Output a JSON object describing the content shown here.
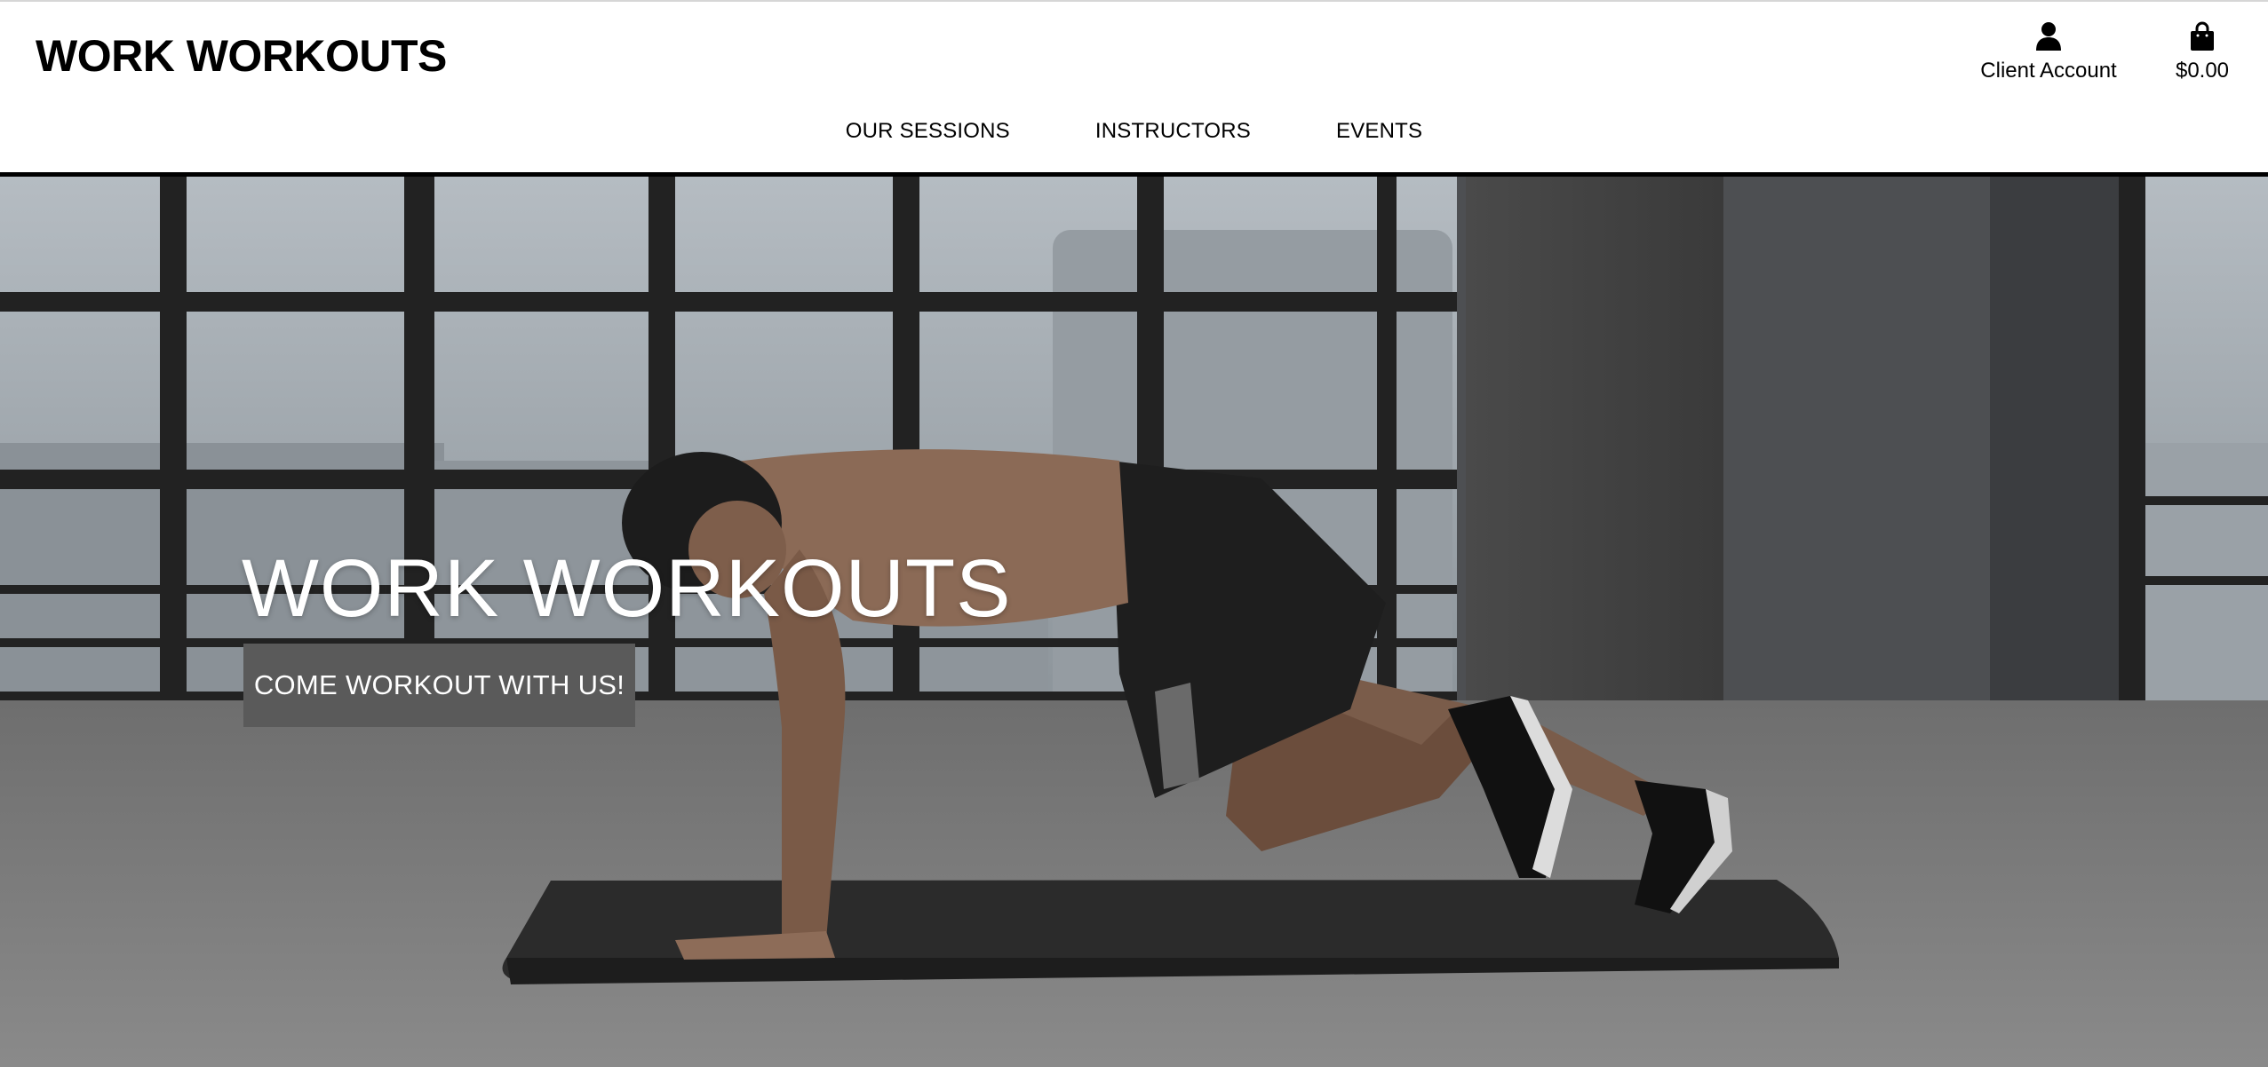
{
  "header": {
    "brand": "WORK WORKOUTS",
    "account_label": "Client Account",
    "cart_total": "$0.00",
    "account_icon": "user-icon",
    "cart_icon": "shopping-bag-icon"
  },
  "nav": {
    "items": [
      {
        "label": "OUR SESSIONS"
      },
      {
        "label": "INSTRUCTORS"
      },
      {
        "label": "EVENTS"
      }
    ]
  },
  "hero": {
    "title": "WORK WORKOUTS",
    "cta_label": "COME WORKOUT WITH US!",
    "image": "man doing mountain-climber exercise on a mat in an empty loft with large windows"
  },
  "colors": {
    "header_bg": "#ffffff",
    "divider": "#000000",
    "cta_bg": "#5a5a5a",
    "hero_text": "#ffffff"
  }
}
